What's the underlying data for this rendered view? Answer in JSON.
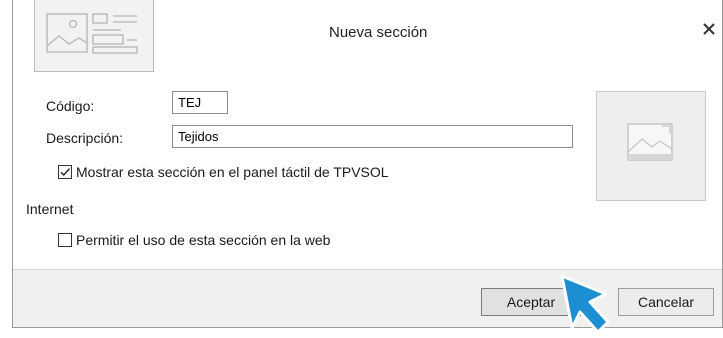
{
  "dialog": {
    "title": "Nueva sección",
    "close_glyph": "✕"
  },
  "form": {
    "codigo_label": "Código:",
    "codigo_value": "TEJ",
    "descripcion_label": "Descripción:",
    "descripcion_value": "Tejidos",
    "tactil_checkbox": {
      "label": "Mostrar esta sección en el panel táctil de TPVSOL",
      "checked": true
    },
    "internet_heading": "Internet",
    "web_checkbox": {
      "label": "Permitir el uso de esta sección en la web",
      "checked": false
    }
  },
  "buttons": {
    "ok_label": "Aceptar",
    "cancel_label": "Cancelar"
  },
  "colors": {
    "cursor": "#1b8fd1",
    "cursor_outline": "#ffffff",
    "footer": "#f0f0f0",
    "image_placeholder": "#eeeeee"
  },
  "icons": {
    "header": "section-thumbnail-icon",
    "image": "image-placeholder-icon",
    "close": "close-icon",
    "pointer": "mouse-pointer-icon"
  }
}
